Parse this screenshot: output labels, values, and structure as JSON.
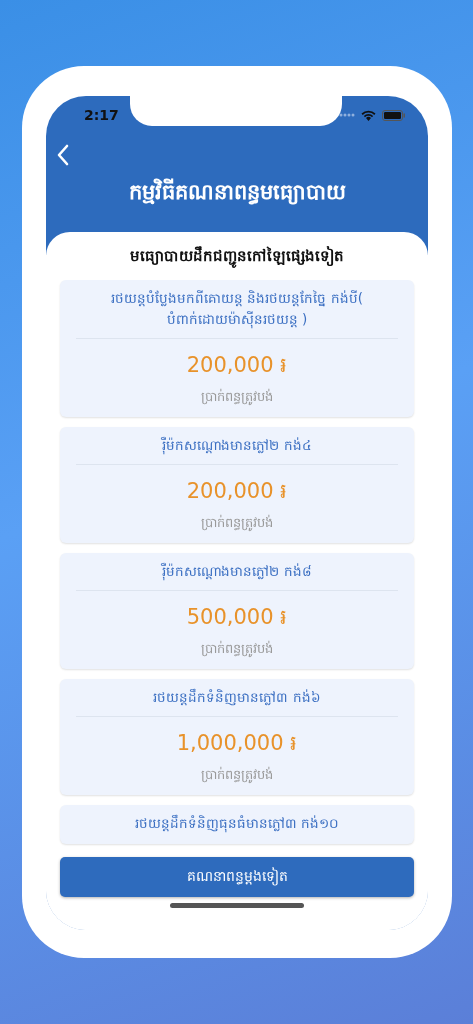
{
  "status_bar": {
    "time": "2:17"
  },
  "header": {
    "title": "កម្មវិធីគណនាពន្ធមធ្យោបាយ"
  },
  "section_title": "មធ្យោបាយដឹកជញ្ជូនកៅឡៃផ្សេងទៀត",
  "items": [
    {
      "name": "រថយន្តបំប្លែងមកពីគោយន្ត និងរថយន្តកែច្នៃ កង់បី( បំពាក់ដោយម៉ាស៊ីនរថយន្ត )",
      "amount": "200,000 ៛",
      "caption": "ប្រាក់ពន្ធត្រូវបង់"
    },
    {
      "name": "រ៉ឺម៉កសណ្តោងមានភ្លៅ២ កង់៤",
      "amount": "200,000 ៛",
      "caption": "ប្រាក់ពន្ធត្រូវបង់"
    },
    {
      "name": "រ៉ឺម៉កសណ្តោងមានភ្លៅ២ កង់៨",
      "amount": "500,000 ៛",
      "caption": "ប្រាក់ពន្ធត្រូវបង់"
    },
    {
      "name": "រថយន្តដឹកទំនិញមានភ្លៅ៣ កង់៦",
      "amount": "1,000,000 ៛",
      "caption": "ប្រាក់ពន្ធត្រូវបង់"
    },
    {
      "name": "រថយន្តដឹកទំនិញធុនធំមានភ្លៅ៣ កង់១០"
    }
  ],
  "button": "គណនាពន្ធម្តងទៀត"
}
